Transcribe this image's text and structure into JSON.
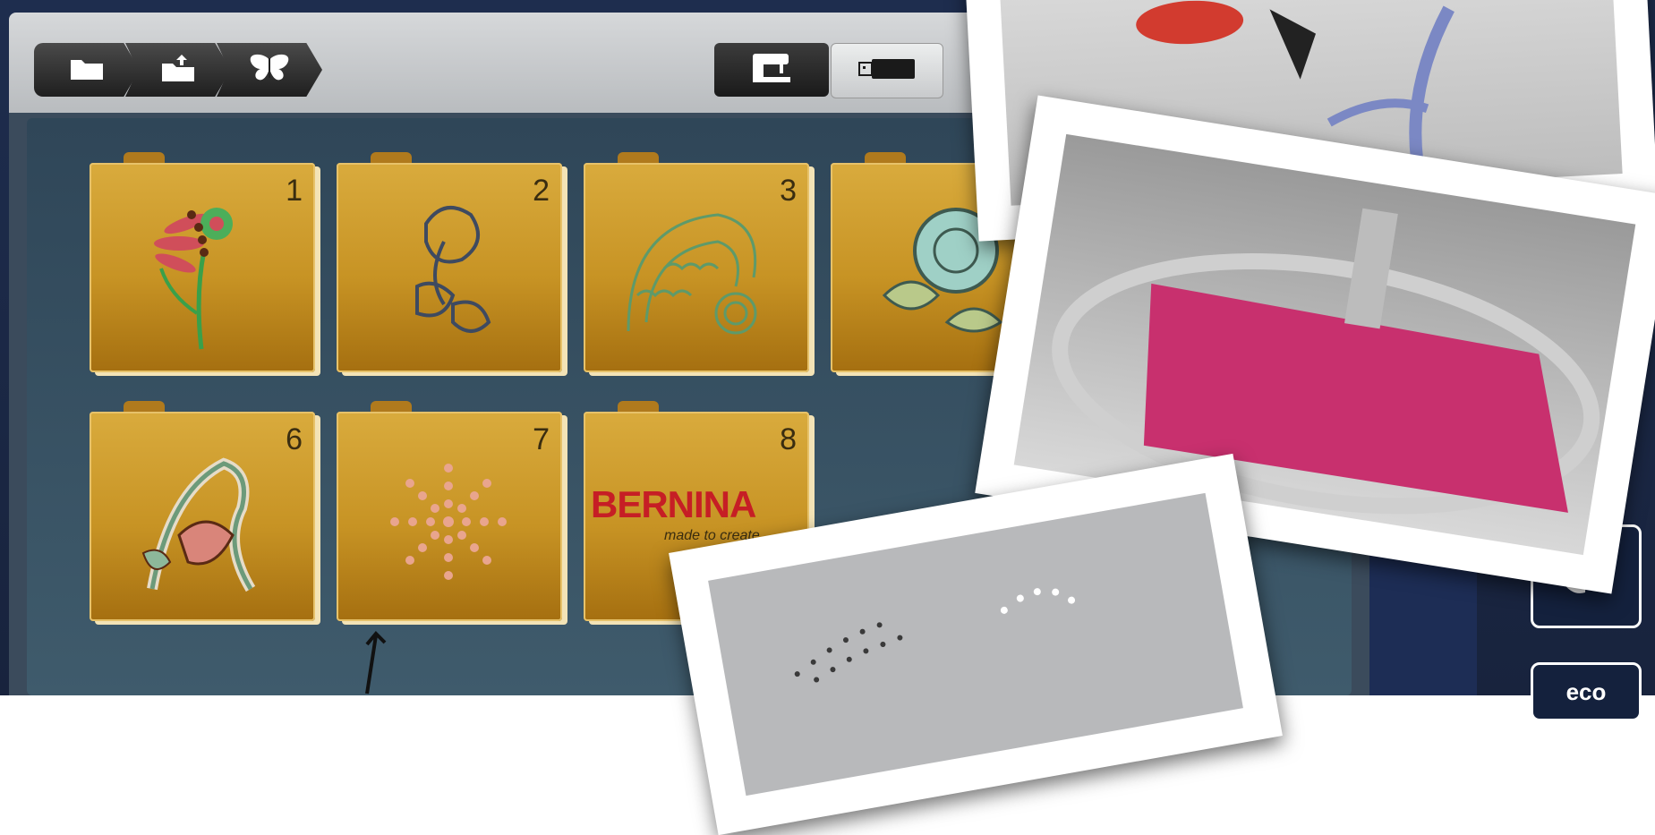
{
  "toolbar": {
    "breadcrumbs": [
      {
        "name": "folder-icon"
      },
      {
        "name": "folder-upload-icon"
      },
      {
        "name": "butterfly-icon"
      }
    ],
    "mode_toggle": {
      "left": "sewing-machine-icon",
      "right": "usb-stick-icon"
    }
  },
  "folders": [
    {
      "number": "1",
      "art": "flower-embroidery"
    },
    {
      "number": "2",
      "art": "leaf-flower-embroidery"
    },
    {
      "number": "3",
      "art": "quilt-feather-embroidery"
    },
    {
      "number": "",
      "art": "rose-embroidery"
    },
    {
      "number": "6",
      "art": "paisley-letter-embroidery"
    },
    {
      "number": "7",
      "art": "crystal-burst-embroidery"
    },
    {
      "number": "8",
      "art": "brand-logo",
      "brand": "BERNINA",
      "brand_sub": "made to create"
    }
  ],
  "side_buttons": [
    {
      "name": "settings-icon"
    },
    {
      "name": "color-palette-icon"
    },
    {
      "name": "eco-button",
      "label": "eco"
    }
  ],
  "colors": {
    "folder_gold": "#c79324",
    "topbar": "#c8cacc",
    "screen_bg": "#34495a",
    "bezel": "#1e2d4e",
    "brand_red": "#c61e25"
  }
}
